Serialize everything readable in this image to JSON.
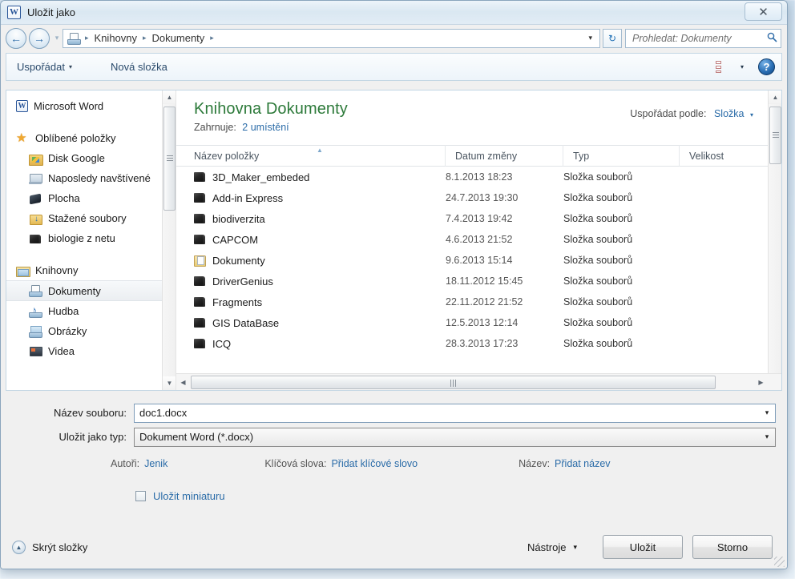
{
  "window": {
    "title": "Uložit jako",
    "app_icon": "word-icon",
    "close_label": "✕"
  },
  "address_bar": {
    "back_icon": "←",
    "forward_icon": "→",
    "recent_caret": "▾",
    "location_icon": "documents-library-icon",
    "breadcrumbs": [
      "Knihovny",
      "Dokumenty"
    ],
    "separator": "▸",
    "dropdown_caret": "▾",
    "refresh_icon": "↻",
    "search_placeholder": "Prohledat: Dokumenty",
    "search_icon": "🔍"
  },
  "toolbar": {
    "organize_label": "Uspořádat",
    "organize_caret": "▾",
    "new_folder_label": "Nová složka",
    "view_caret": "▾",
    "help_label": "?"
  },
  "sidebar": {
    "items": [
      {
        "label": "Microsoft Word",
        "icon": "word-icon",
        "kind": "app",
        "indent": false,
        "selected": false
      },
      {
        "label": "Oblíbené položky",
        "icon": "star-icon",
        "kind": "favorites-header",
        "indent": false,
        "selected": false
      },
      {
        "label": "Disk Google",
        "icon": "google-drive-folder-icon",
        "kind": "child",
        "indent": true,
        "selected": false
      },
      {
        "label": "Naposledy navštívené",
        "icon": "recent-places-icon",
        "kind": "child",
        "indent": true,
        "selected": false
      },
      {
        "label": "Plocha",
        "icon": "desktop-icon",
        "kind": "child",
        "indent": true,
        "selected": false
      },
      {
        "label": "Stažené soubory",
        "icon": "downloads-folder-icon",
        "kind": "child",
        "indent": true,
        "selected": false
      },
      {
        "label": "biologie z netu",
        "icon": "dark-folder-icon",
        "kind": "child",
        "indent": true,
        "selected": false
      },
      {
        "label": "Knihovny",
        "icon": "libraries-icon",
        "kind": "libraries-header",
        "indent": false,
        "selected": false
      },
      {
        "label": "Dokumenty",
        "icon": "documents-library-icon",
        "kind": "child",
        "indent": true,
        "selected": true
      },
      {
        "label": "Hudba",
        "icon": "music-library-icon",
        "kind": "child",
        "indent": true,
        "selected": false
      },
      {
        "label": "Obrázky",
        "icon": "pictures-library-icon",
        "kind": "child",
        "indent": true,
        "selected": false
      },
      {
        "label": "Videa",
        "icon": "videos-library-icon",
        "kind": "child",
        "indent": true,
        "selected": false
      }
    ],
    "scroll_up_icon": "▲",
    "scroll_down_icon": "▼"
  },
  "content": {
    "library_title": "Knihovna Dokumenty",
    "includes_label": "Zahrnuje:",
    "includes_value": "2 umístění",
    "arrange_label": "Uspořádat podle:",
    "arrange_value": "Složka",
    "arrange_caret": "▾",
    "sort_indicator": "▲",
    "columns": [
      "Název položky",
      "Datum změny",
      "Typ",
      "Velikost"
    ],
    "rows": [
      {
        "name": "3D_Maker_embeded",
        "date": "8.1.2013 18:23",
        "type": "Složka souborů",
        "size": "",
        "icon": "dark-folder-icon"
      },
      {
        "name": "Add-in Express",
        "date": "24.7.2013 19:30",
        "type": "Složka souborů",
        "size": "",
        "icon": "dark-folder-icon"
      },
      {
        "name": "biodiverzita",
        "date": "7.4.2013 19:42",
        "type": "Složka souborů",
        "size": "",
        "icon": "dark-folder-icon"
      },
      {
        "name": "CAPCOM",
        "date": "4.6.2013 21:52",
        "type": "Složka souborů",
        "size": "",
        "icon": "dark-folder-icon"
      },
      {
        "name": "Dokumenty",
        "date": "9.6.2013 15:14",
        "type": "Složka souborů",
        "size": "",
        "icon": "documents-folder-icon"
      },
      {
        "name": "DriverGenius",
        "date": "18.11.2012 15:45",
        "type": "Složka souborů",
        "size": "",
        "icon": "dark-folder-icon"
      },
      {
        "name": "Fragments",
        "date": "22.11.2012 21:52",
        "type": "Složka souborů",
        "size": "",
        "icon": "dark-folder-icon"
      },
      {
        "name": "GIS DataBase",
        "date": "12.5.2013 12:14",
        "type": "Složka souborů",
        "size": "",
        "icon": "dark-folder-icon"
      },
      {
        "name": "ICQ",
        "date": "28.3.2013 17:23",
        "type": "Složka souborů",
        "size": "",
        "icon": "dark-folder-icon"
      }
    ],
    "hscroll_left_icon": "◀",
    "hscroll_right_icon": "▶"
  },
  "form": {
    "filename_label": "Název souboru:",
    "filename_value": "doc1.docx",
    "filetype_label": "Uložit jako typ:",
    "filetype_value": "Dokument Word (*.docx)",
    "combo_caret": "▾",
    "authors_label": "Autoři:",
    "authors_value": "Jenik",
    "keywords_label": "Klíčová slova:",
    "keywords_value": "Přidat klíčové slovo",
    "title_label": "Název:",
    "title_value": "Přidat název",
    "thumbnail_label": "Uložit miniaturu",
    "thumbnail_checked": false
  },
  "footer": {
    "hide_folders_label": "Skrýt složky",
    "hide_folders_icon": "▲",
    "tools_label": "Nástroje",
    "tools_caret": "▾",
    "save_label": "Uložit",
    "cancel_label": "Storno"
  },
  "colors": {
    "library_title_green": "#2d7a3a",
    "link_blue": "#2b6ca8",
    "window_border": "#8aa5bd",
    "dialog_bg": "#f0f0f0"
  }
}
